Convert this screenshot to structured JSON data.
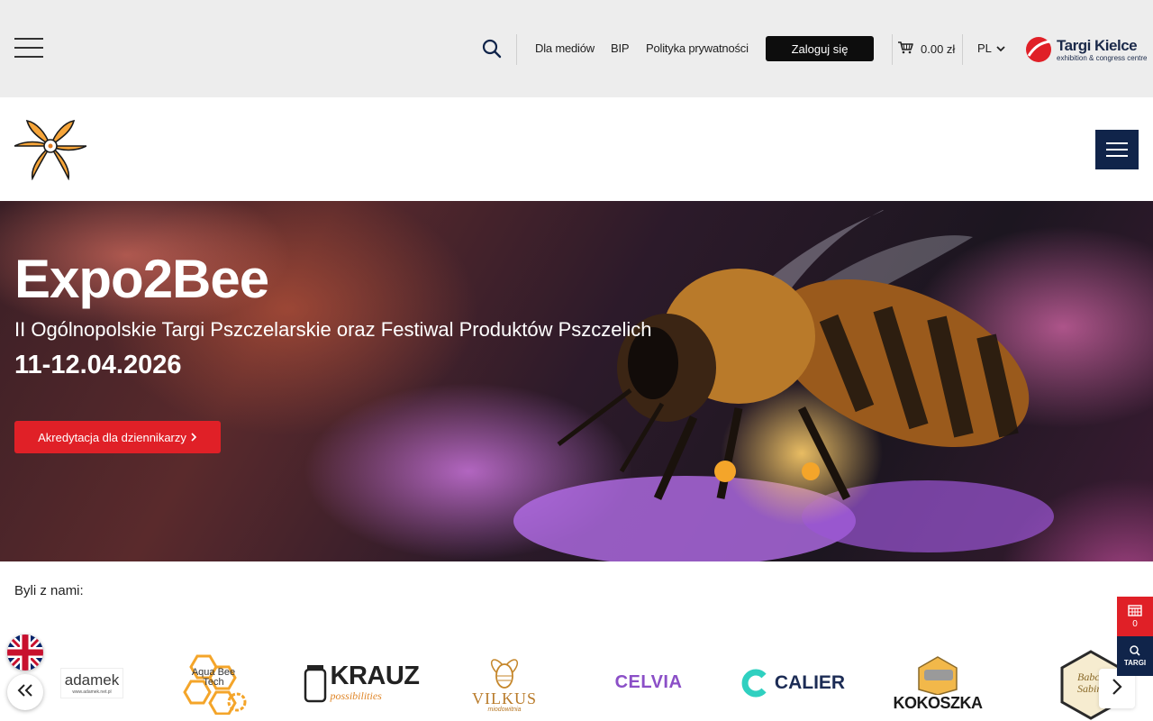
{
  "topbar": {
    "links": [
      "Dla mediów",
      "BIP",
      "Polityka prywatności"
    ],
    "login_label": "Zaloguj się",
    "cart_amount": "0.00 zł",
    "language": "PL",
    "brand": {
      "name": "Targi Kielce",
      "tagline": "exhibition & congress centre"
    }
  },
  "hero": {
    "title": "Expo2Bee",
    "subtitle": "II Ogólnopolskie Targi Pszczelarskie oraz Festiwal Produktów Pszczelich",
    "date": "11-12.04.2026",
    "cta_label": "Akredytacja dla dziennikarzy"
  },
  "partners": {
    "heading": "Byli z nami:",
    "logos": [
      {
        "name": "adamek",
        "text": "adamek",
        "url_text": "www.adamek.net.pl"
      },
      {
        "name": "aqua-bee-tech",
        "text": "Aqua Bee Tech"
      },
      {
        "name": "krauz",
        "text": "KRAUZ",
        "sub": "possibilities"
      },
      {
        "name": "vilkus",
        "text": "VILKUS",
        "sub": "miodowitnia"
      },
      {
        "name": "celvia",
        "text": "CELVIA"
      },
      {
        "name": "calier",
        "text": "CALIER"
      },
      {
        "name": "kokoszka",
        "text": "KOKOSZKA"
      },
      {
        "name": "babcia-sabina",
        "text": "Babcia Sabina"
      }
    ]
  },
  "side_widget": {
    "calendar_count": "0",
    "targi_label": "TARGI"
  },
  "colors": {
    "accent_red": "#e02027",
    "navy": "#10244a",
    "topbar_bg": "#ededed"
  },
  "icons": [
    "menu-icon",
    "search-icon",
    "cart-icon",
    "chevron-down-icon",
    "chevron-right-icon",
    "double-chevron-left-icon",
    "uk-flag-icon",
    "calendar-icon"
  ]
}
